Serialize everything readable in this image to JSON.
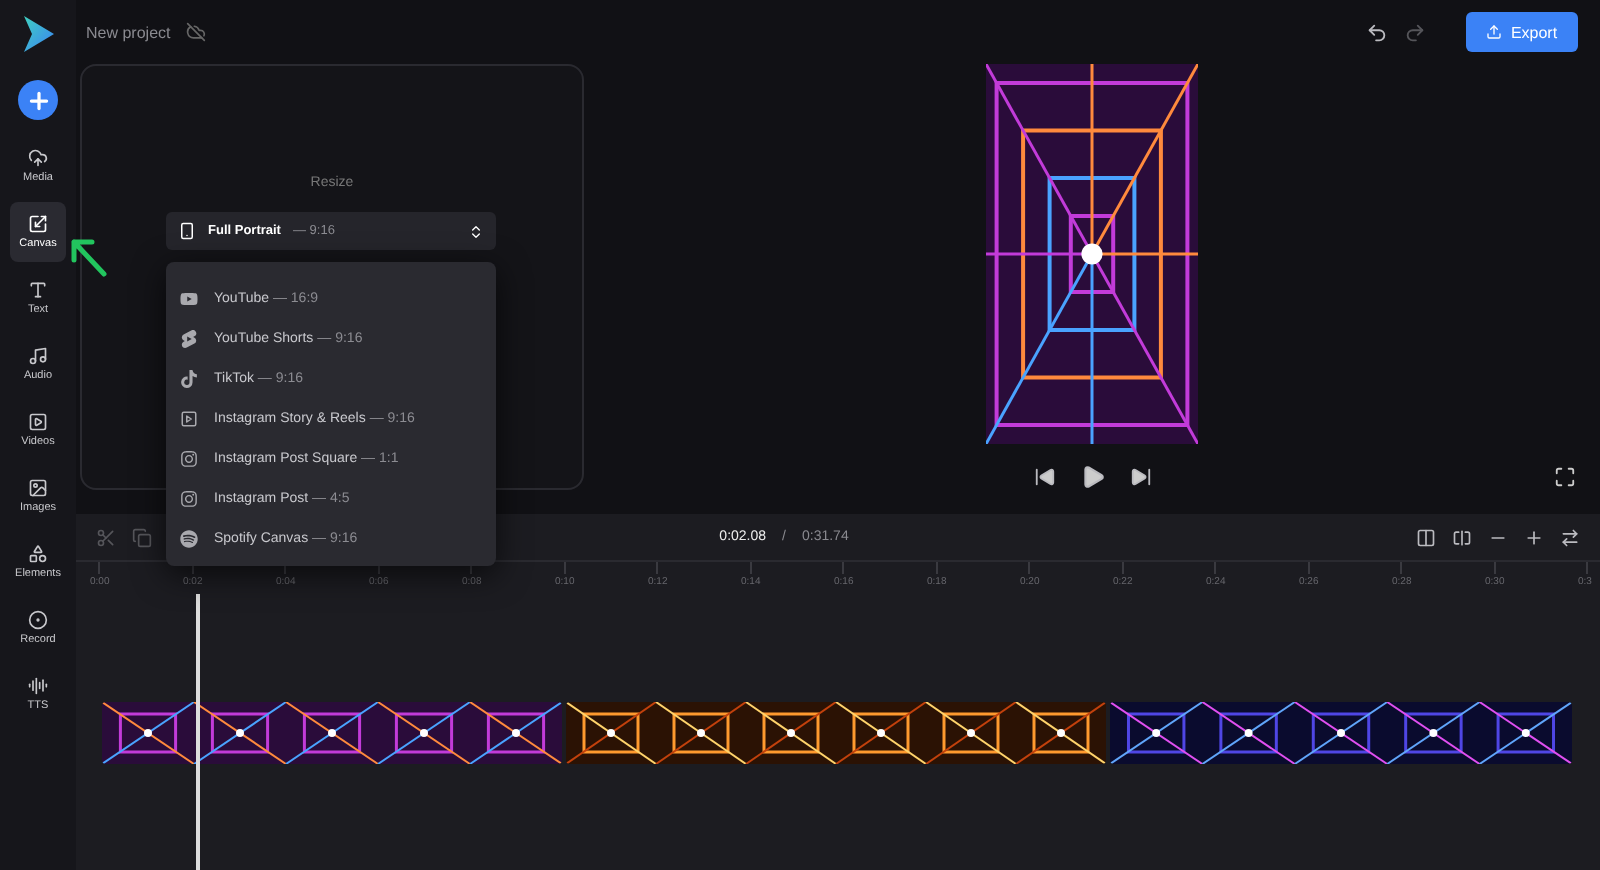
{
  "header": {
    "project_name": "New project",
    "export_label": "Export",
    "undo_disabled": false,
    "redo_disabled": true
  },
  "sidebar": {
    "items": [
      {
        "label": "Media",
        "kind": "media",
        "selected": false
      },
      {
        "label": "Canvas",
        "kind": "canvas",
        "selected": true
      },
      {
        "label": "Text",
        "kind": "text",
        "selected": false
      },
      {
        "label": "Audio",
        "kind": "audio",
        "selected": false
      },
      {
        "label": "Videos",
        "kind": "videos",
        "selected": false
      },
      {
        "label": "Images",
        "kind": "images",
        "selected": false
      },
      {
        "label": "Elements",
        "kind": "elements",
        "selected": false
      },
      {
        "label": "Record",
        "kind": "record",
        "selected": false
      },
      {
        "label": "TTS",
        "kind": "tts",
        "selected": false
      }
    ]
  },
  "canvas_panel": {
    "title": "Resize",
    "select": {
      "name": "Full Portrait",
      "ratio": "— 9:16"
    },
    "options": [
      {
        "kind": "youtube",
        "name": "YouTube",
        "ratio": "— 16:9"
      },
      {
        "kind": "shorts",
        "name": "YouTube Shorts",
        "ratio": "— 9:16"
      },
      {
        "kind": "tiktok",
        "name": "TikTok",
        "ratio": "— 9:16"
      },
      {
        "kind": "story",
        "name": "Instagram Story & Reels",
        "ratio": "— 9:16"
      },
      {
        "kind": "instagram",
        "name": "Instagram Post Square",
        "ratio": "— 1:1"
      },
      {
        "kind": "instagram",
        "name": "Instagram Post",
        "ratio": "— 4:5"
      },
      {
        "kind": "spotify",
        "name": "Spotify Canvas",
        "ratio": "— 9:16"
      }
    ]
  },
  "timeline": {
    "current_time": "0:02.08",
    "separator": "/",
    "total_time": "0:31.74",
    "ruler": [
      "0:00",
      "0:02",
      "0:04",
      "0:06",
      "0:08",
      "0:10",
      "0:12",
      "0:14",
      "0:16",
      "0:18",
      "0:20",
      "0:22",
      "0:24",
      "0:26",
      "0:28",
      "0:30",
      "0:3"
    ]
  }
}
